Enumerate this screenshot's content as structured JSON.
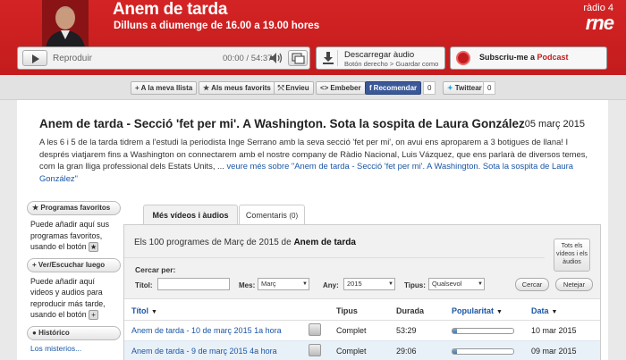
{
  "header": {
    "program_title": "Anem de tarda",
    "schedule": "Dilluns a diumenge de 16.00 a 19.00 hores",
    "brand_top": "ràdio 4",
    "brand_main": "rne"
  },
  "player": {
    "play_label": "Reproduir",
    "time": "00:00 / 54:37"
  },
  "download": {
    "title": "Descarregar àudio",
    "subtitle": "Botón derecho > Guardar como"
  },
  "podcast": {
    "label": "Subscriu-me a ",
    "highlight": "Podcast"
  },
  "share_bar": {
    "my_list": "A la meva llista",
    "favorites": "Als meus favorits",
    "send": "Envieu",
    "embed": "Embeber",
    "recommend": "Recomendar",
    "recommend_count": "0",
    "tweet": "Twittear",
    "tweet_count": "0"
  },
  "episode": {
    "title": "Anem de tarda - Secció 'fet per mi'. A Washington. Sota la sospita de Laura González",
    "date": "05 març 2015",
    "description": "A les 6 i 5 de la tarda tidrem a l'estudi  la periodista Inge Serrano amb la seva secció 'fet  per mi', on avui ens aproparem a 3 botigues de llana! I després viatjarem fins a Washington on connectarem amb el nostre company de Ràdio Nacional, Luis Vázquez, que ens parlarà de diversos temes, com la gran lliga professional dels Estats Units, ...",
    "more_link": " veure més sobre \"Anem de tarda - Secció 'fet per mi'. A Washington. Sota la sospita de Laura González\""
  },
  "sidebar": {
    "favorites_head": "Programas favoritos",
    "favorites_text": "Puede añadir aquí sus programas favoritos, usando el botón",
    "watch_head": "Ver/Escuchar luego",
    "watch_text": "Puede añadir aquí videos y audios para reproducir más tarde, usando el botón",
    "history_head": "Histórico",
    "history_link": "Los misterios..."
  },
  "tabs": {
    "active": "Més vídeos i àudios",
    "comments_label": "Comentaris",
    "comments_count": "(0)"
  },
  "panel": {
    "heading_prefix": "Els 100 programes de Març de 2015 de ",
    "heading_bold": "Anem de tarda",
    "all_button": "Tots els vídeos i els àudios",
    "search_label": "Cercar per:",
    "title_label": "Títol:",
    "month_label": "Mes:",
    "month_value": "Març",
    "year_label": "Any:",
    "year_value": "2015",
    "type_label": "Tipus:",
    "type_value": "Qualsevol",
    "search_button": "Cercar",
    "clear_button": "Netejar"
  },
  "table": {
    "headers": {
      "title": "Títol",
      "type": "Tipus",
      "duration": "Durada",
      "popularity": "Popularitat",
      "date": "Data"
    },
    "rows": [
      {
        "title": "Anem de tarda - 10 de març 2015 1a hora",
        "type": "Complet",
        "duration": "53:29",
        "popularity": 0.07,
        "date": "10 mar 2015"
      },
      {
        "title": "Anem de tarda - 9 de març 2015 4a hora",
        "type": "Complet",
        "duration": "29:06",
        "popularity": 0.07,
        "date": "09 mar 2015"
      }
    ]
  },
  "colors": {
    "brand_red": "#c31c1d",
    "link_blue": "#1a56a6",
    "facebook_blue": "#3b5998"
  }
}
